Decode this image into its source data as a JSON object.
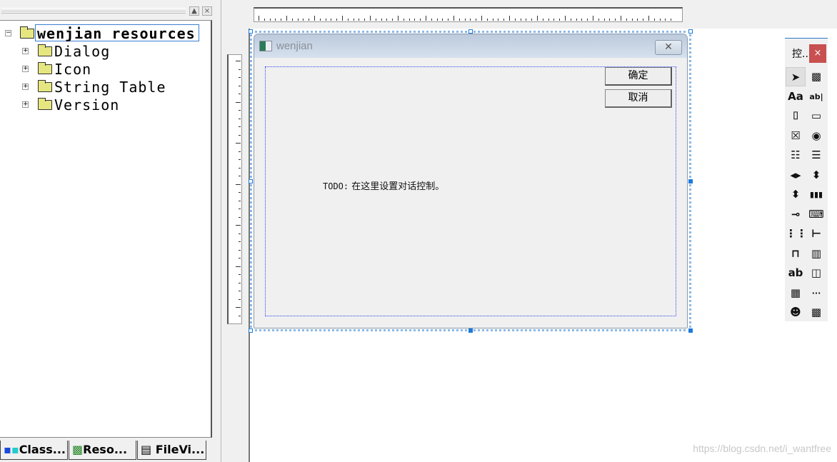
{
  "workspace_tree": {
    "root": "wenjian resources",
    "items": [
      {
        "label": "Dialog"
      },
      {
        "label": "Icon"
      },
      {
        "label": "String Table"
      },
      {
        "label": "Version"
      }
    ],
    "pane_buttons": {
      "maximize": "▲",
      "close": "×"
    }
  },
  "workspace_tabs": [
    {
      "label": "Class...",
      "icon": "class-view-icon"
    },
    {
      "label": "Reso...",
      "icon": "resource-view-icon"
    },
    {
      "label": "FileVi...",
      "icon": "file-view-icon"
    }
  ],
  "dialog": {
    "title": "wenjian",
    "close_glyph": "✕",
    "ok_label": "确定",
    "cancel_label": "取消",
    "todo_prefix": "TODO:",
    "todo_text": " 在这里设置对话控制。"
  },
  "toolbox": {
    "title": "控..",
    "close_glyph": "×",
    "tools": [
      {
        "name": "pointer",
        "glyph": "➤"
      },
      {
        "name": "picture",
        "glyph": "▩"
      },
      {
        "name": "static-text",
        "glyph": "Aa"
      },
      {
        "name": "edit-box",
        "glyph": "ab|"
      },
      {
        "name": "group-box",
        "glyph": "⌷"
      },
      {
        "name": "button",
        "glyph": "▭"
      },
      {
        "name": "check-box",
        "glyph": "☒"
      },
      {
        "name": "radio-button",
        "glyph": "◉"
      },
      {
        "name": "combo-box",
        "glyph": "☷"
      },
      {
        "name": "list-box",
        "glyph": "☰"
      },
      {
        "name": "horizontal-scrollbar",
        "glyph": "◂▸"
      },
      {
        "name": "vertical-scrollbar",
        "glyph": "⬍"
      },
      {
        "name": "spin",
        "glyph": "⬍"
      },
      {
        "name": "progress",
        "glyph": "▮▮▮"
      },
      {
        "name": "slider",
        "glyph": "⊸"
      },
      {
        "name": "hotkey",
        "glyph": "⌨"
      },
      {
        "name": "list-control",
        "glyph": "⋮⋮"
      },
      {
        "name": "tree-control",
        "glyph": "⊢"
      },
      {
        "name": "tab-control",
        "glyph": "⊓"
      },
      {
        "name": "animate",
        "glyph": "▥"
      },
      {
        "name": "rich-edit",
        "glyph": "ab"
      },
      {
        "name": "date-time-picker",
        "glyph": "◫"
      },
      {
        "name": "month-calendar",
        "glyph": "▦"
      },
      {
        "name": "ip-address",
        "glyph": "···"
      },
      {
        "name": "custom-control",
        "glyph": "☻"
      },
      {
        "name": "extended-combo",
        "glyph": "▩"
      }
    ]
  },
  "watermark": "https://blog.csdn.net/i_wantfree"
}
